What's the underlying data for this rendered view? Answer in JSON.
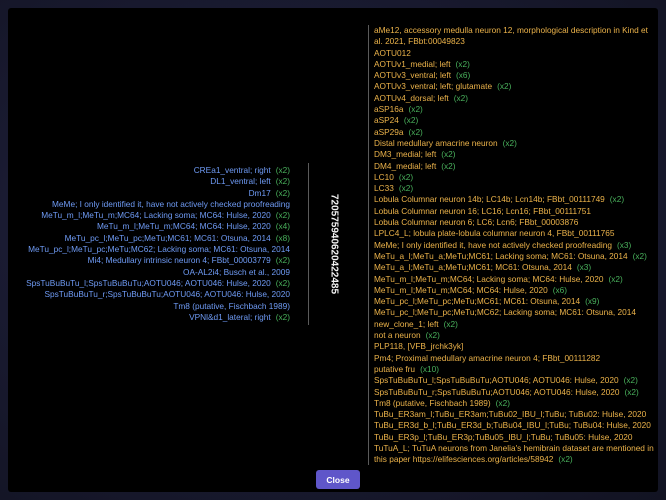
{
  "center_id": "720575940620422485",
  "close_label": "Close",
  "colors": {
    "left_text": "#6f9bf5",
    "right_text": "#ecb34a",
    "count": "#49b15c",
    "button": "#5f56c9"
  },
  "left_items": [
    {
      "text": "CREa1_ventral; right",
      "count": "(x2)"
    },
    {
      "text": "DL1_ventral; left",
      "count": "(x2)"
    },
    {
      "text": "Dm17",
      "count": "(x2)"
    },
    {
      "text": "MeMe; I only identified it, have not actively checked proofreading",
      "count": ""
    },
    {
      "text": "MeTu_m_l;MeTu_m;MC64; Lacking soma; MC64: Hulse, 2020",
      "count": "(x2)"
    },
    {
      "text": "MeTu_m_l;MeTu_m;MC64; MC64: Hulse, 2020",
      "count": "(x4)"
    },
    {
      "text": "MeTu_pc_l;MeTu_pc;MeTu;MC61; MC61: Otsuna, 2014",
      "count": "(x8)"
    },
    {
      "text": "MeTu_pc_l;MeTu_pc;MeTu;MC62; Lacking soma; MC61: Otsuna, 2014",
      "count": ""
    },
    {
      "text": "Mi4; Medullary intrinsic neuron 4; FBbt_00003779",
      "count": "(x2)"
    },
    {
      "text": "OA-AL2i4; Busch et al., 2009",
      "count": ""
    },
    {
      "text": "SpsTuBuBuTu_l;SpsTuBuBuTu;AOTU046; AOTU046: Hulse, 2020",
      "count": "(x2)"
    },
    {
      "text": "SpsTuBuBuTu_r;SpsTuBuBuTu;AOTU046; AOTU046: Hulse, 2020",
      "count": ""
    },
    {
      "text": "Tm8 (putative, Fischbach 1989)",
      "count": ""
    },
    {
      "text": "VPNl&d1_lateral; right",
      "count": "(x2)"
    }
  ],
  "right_items": [
    {
      "text": "aMe12, accessory medulla neuron 12, morphological description in Kind et al. 2021, FBbt:00049823",
      "count": ""
    },
    {
      "text": "AOTU012",
      "count": ""
    },
    {
      "text": "AOTUv1_medial; left",
      "count": "(x2)"
    },
    {
      "text": "AOTUv3_ventral; left",
      "count": "(x6)"
    },
    {
      "text": "AOTUv3_ventral; left; glutamate",
      "count": "(x2)"
    },
    {
      "text": "AOTUv4_dorsal; left",
      "count": "(x2)"
    },
    {
      "text": "aSP16a",
      "count": "(x2)"
    },
    {
      "text": "aSP24",
      "count": "(x2)"
    },
    {
      "text": "aSP29a",
      "count": "(x2)"
    },
    {
      "text": "Distal medullary amacrine neuron",
      "count": "(x2)"
    },
    {
      "text": "DM3_medial; left",
      "count": "(x2)"
    },
    {
      "text": "DM4_medial; left",
      "count": "(x2)"
    },
    {
      "text": "LC10",
      "count": "(x2)"
    },
    {
      "text": "LC33",
      "count": "(x2)"
    },
    {
      "text": "Lobula Columnar neuron 14b; LC14b; Lcn14b; FBbt_00111749",
      "count": "(x2)"
    },
    {
      "text": "Lobula Columnar neuron 16; LC16; Lcn16; FBbt_00111751",
      "count": ""
    },
    {
      "text": "Lobula Columnar neuron 6; LC6; Lcn6; FBbt_00003876",
      "count": ""
    },
    {
      "text": "LPLC4_L; lobula plate-lobula columnar neuron 4, FBbt_00111765",
      "count": ""
    },
    {
      "text": "MeMe; I only identified it, have not actively checked proofreading",
      "count": "(x3)"
    },
    {
      "text": "MeTu_a_l;MeTu_a;MeTu;MC61; Lacking soma; MC61: Otsuna, 2014",
      "count": "(x2)"
    },
    {
      "text": "MeTu_a_l;MeTu_a;MeTu;MC61; MC61: Otsuna, 2014",
      "count": "(x3)"
    },
    {
      "text": "MeTu_m_l;MeTu_m;MC64; Lacking soma; MC64: Hulse, 2020",
      "count": "(x2)"
    },
    {
      "text": "MeTu_m_l;MeTu_m;MC64; MC64: Hulse, 2020",
      "count": "(x6)"
    },
    {
      "text": "MeTu_pc_l;MeTu_pc;MeTu;MC61; MC61: Otsuna, 2014",
      "count": "(x9)"
    },
    {
      "text": "MeTu_pc_l;MeTu_pc;MeTu;MC62; Lacking soma; MC61: Otsuna, 2014",
      "count": ""
    },
    {
      "text": "new_clone_1; left",
      "count": "(x2)"
    },
    {
      "text": "not a neuron",
      "count": "(x2)"
    },
    {
      "text": "PLP118, [VFB_jrchk3yk]",
      "count": ""
    },
    {
      "text": "Pm4; Proximal medullary amacrine neuron 4; FBbt_00111282",
      "count": ""
    },
    {
      "text": "putative fru",
      "count": "(x10)"
    },
    {
      "text": "SpsTuBuBuTu_l;SpsTuBuBuTu;AOTU046; AOTU046: Hulse, 2020",
      "count": "(x2)"
    },
    {
      "text": "SpsTuBuBuTu_r;SpsTuBuBuTu;AOTU046; AOTU046: Hulse, 2020",
      "count": "(x2)"
    },
    {
      "text": "Tm8 (putative, Fischbach 1989)",
      "count": "(x2)"
    },
    {
      "text": "TuBu_ER3am_l;TuBu_ER3am;TuBu02_IBU_l;TuBu; TuBu02: Hulse, 2020",
      "count": ""
    },
    {
      "text": "TuBu_ER3d_b_l;TuBu_ER3d_b;TuBu04_IBU_l;TuBu; TuBu04: Hulse, 2020",
      "count": ""
    },
    {
      "text": "TuBu_ER3p_l;TuBu_ER3p;TuBu05_IBU_l;TuBu; TuBu05: Hulse, 2020",
      "count": ""
    },
    {
      "text": "TuTuA_L; TuTuA neurons from Janelia's hemibrain dataset are mentioned in this paper https://elifesciences.org/articles/58942",
      "count": "(x2)"
    }
  ]
}
